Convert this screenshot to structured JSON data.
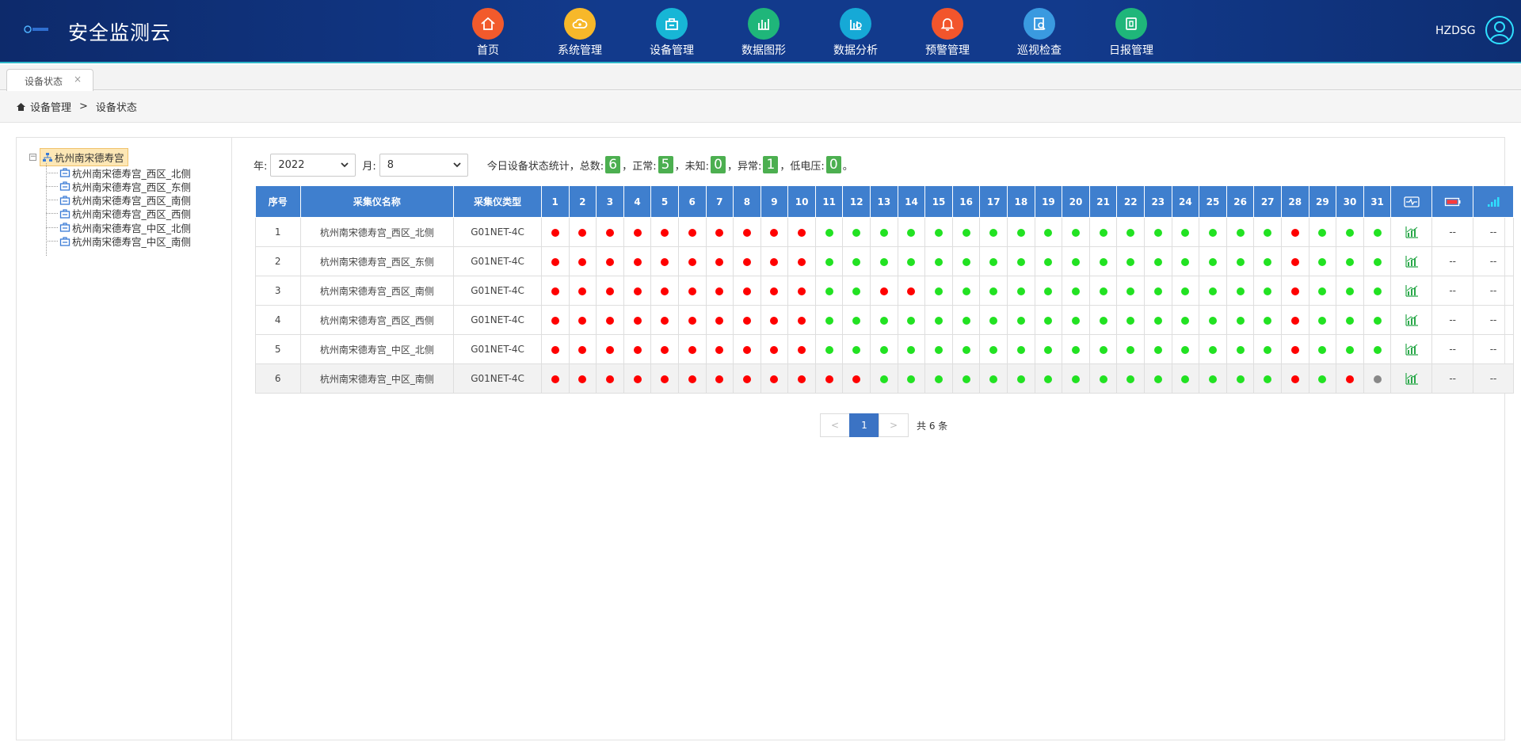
{
  "app": {
    "title": "安全监测云",
    "user": "HZDSG"
  },
  "nav": [
    {
      "label": "首页",
      "icon": "home-icon",
      "color": "#f25a2c"
    },
    {
      "label": "系统管理",
      "icon": "cloud-gear-icon",
      "color": "#f7b82a"
    },
    {
      "label": "设备管理",
      "icon": "device-icon",
      "color": "#17b6d6"
    },
    {
      "label": "数据图形",
      "icon": "bar-chart-icon",
      "color": "#1fb67a"
    },
    {
      "label": "数据分析",
      "icon": "analysis-icon",
      "color": "#16a9d6"
    },
    {
      "label": "预警管理",
      "icon": "bell-icon",
      "color": "#f2552c"
    },
    {
      "label": "巡视检查",
      "icon": "inspect-icon",
      "color": "#3a9ae0"
    },
    {
      "label": "日报管理",
      "icon": "daily-report-icon",
      "color": "#1fb67a"
    }
  ],
  "tabs": [
    {
      "label": "设备状态",
      "close": "×"
    }
  ],
  "breadcrumb": {
    "parent": "设备管理",
    "separator": ">",
    "current": "设备状态"
  },
  "tree": {
    "toggle": "−",
    "root": "杭州南宋德寿宫",
    "children": [
      "杭州南宋德寿宫_西区_北侧",
      "杭州南宋德寿宫_西区_东侧",
      "杭州南宋德寿宫_西区_南侧",
      "杭州南宋德寿宫_西区_西侧",
      "杭州南宋德寿宫_中区_北侧",
      "杭州南宋德寿宫_中区_南侧"
    ]
  },
  "filters": {
    "year_label": "年:",
    "year_value": "2022",
    "month_label": "月:",
    "month_value": "8"
  },
  "stats": {
    "prefix": "今日设备状态统计，总数:",
    "total": "6",
    "normal_label": "正常:",
    "normal": "5",
    "unknown_label": "未知:",
    "unknown": "0",
    "abnormal_label": "异常:",
    "abnormal": "1",
    "lowvolt_label": "低电压:",
    "lowvolt": "0",
    "comma": "，",
    "end": "。"
  },
  "table": {
    "headers": {
      "index": "序号",
      "name": "采集仪名称",
      "type": "采集仪类型"
    },
    "days": [
      "1",
      "2",
      "3",
      "4",
      "5",
      "6",
      "7",
      "8",
      "9",
      "10",
      "11",
      "12",
      "13",
      "14",
      "15",
      "16",
      "17",
      "18",
      "19",
      "20",
      "21",
      "22",
      "23",
      "24",
      "25",
      "26",
      "27",
      "28",
      "29",
      "30",
      "31"
    ],
    "extra_header_icons": [
      "signal-wave-icon",
      "battery-icon",
      "signal-strength-icon"
    ],
    "status_colors": {
      "r": "#ff0000",
      "g": "#22e222",
      "x": "#888888"
    },
    "rows": [
      {
        "index": "1",
        "name": "杭州南宋德寿宫_西区_北侧",
        "type": "G01NET-4C",
        "status": [
          "r",
          "r",
          "r",
          "r",
          "r",
          "r",
          "r",
          "r",
          "r",
          "r",
          "g",
          "g",
          "g",
          "g",
          "g",
          "g",
          "g",
          "g",
          "g",
          "g",
          "g",
          "g",
          "g",
          "g",
          "g",
          "g",
          "g",
          "r",
          "g",
          "g",
          "g"
        ],
        "battery": "--",
        "signal": "--"
      },
      {
        "index": "2",
        "name": "杭州南宋德寿宫_西区_东侧",
        "type": "G01NET-4C",
        "status": [
          "r",
          "r",
          "r",
          "r",
          "r",
          "r",
          "r",
          "r",
          "r",
          "r",
          "g",
          "g",
          "g",
          "g",
          "g",
          "g",
          "g",
          "g",
          "g",
          "g",
          "g",
          "g",
          "g",
          "g",
          "g",
          "g",
          "g",
          "r",
          "g",
          "g",
          "g"
        ],
        "battery": "--",
        "signal": "--"
      },
      {
        "index": "3",
        "name": "杭州南宋德寿宫_西区_南侧",
        "type": "G01NET-4C",
        "status": [
          "r",
          "r",
          "r",
          "r",
          "r",
          "r",
          "r",
          "r",
          "r",
          "r",
          "g",
          "g",
          "r",
          "r",
          "g",
          "g",
          "g",
          "g",
          "g",
          "g",
          "g",
          "g",
          "g",
          "g",
          "g",
          "g",
          "g",
          "r",
          "g",
          "g",
          "g"
        ],
        "battery": "--",
        "signal": "--"
      },
      {
        "index": "4",
        "name": "杭州南宋德寿宫_西区_西侧",
        "type": "G01NET-4C",
        "status": [
          "r",
          "r",
          "r",
          "r",
          "r",
          "r",
          "r",
          "r",
          "r",
          "r",
          "g",
          "g",
          "g",
          "g",
          "g",
          "g",
          "g",
          "g",
          "g",
          "g",
          "g",
          "g",
          "g",
          "g",
          "g",
          "g",
          "g",
          "r",
          "g",
          "g",
          "g"
        ],
        "battery": "--",
        "signal": "--"
      },
      {
        "index": "5",
        "name": "杭州南宋德寿宫_中区_北侧",
        "type": "G01NET-4C",
        "status": [
          "r",
          "r",
          "r",
          "r",
          "r",
          "r",
          "r",
          "r",
          "r",
          "r",
          "g",
          "g",
          "g",
          "g",
          "g",
          "g",
          "g",
          "g",
          "g",
          "g",
          "g",
          "g",
          "g",
          "g",
          "g",
          "g",
          "g",
          "r",
          "g",
          "g",
          "g"
        ],
        "battery": "--",
        "signal": "--"
      },
      {
        "index": "6",
        "name": "杭州南宋德寿宫_中区_南侧",
        "type": "G01NET-4C",
        "status": [
          "r",
          "r",
          "r",
          "r",
          "r",
          "r",
          "r",
          "r",
          "r",
          "r",
          "r",
          "r",
          "g",
          "g",
          "g",
          "g",
          "g",
          "g",
          "g",
          "g",
          "g",
          "g",
          "g",
          "g",
          "g",
          "g",
          "g",
          "r",
          "g",
          "r",
          "x"
        ],
        "battery": "--",
        "signal": "--"
      }
    ]
  },
  "pagination": {
    "prev": "<",
    "page": "1",
    "next": ">",
    "total": "共 6 条"
  }
}
